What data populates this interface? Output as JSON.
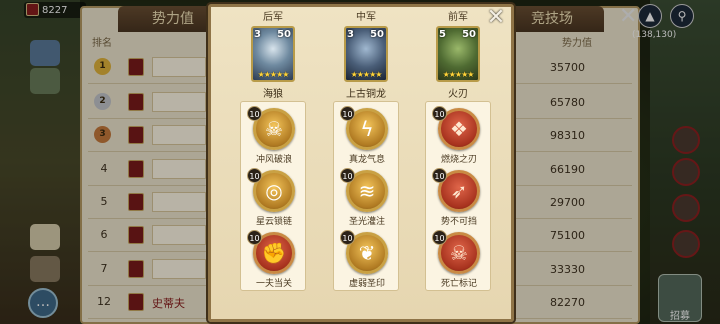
{
  "hud": {
    "resource_value": "8227",
    "coord": "(138,130)"
  },
  "ranking": {
    "tab_power": "势力值",
    "tab_arena": "竞技场",
    "col_rank": "排名",
    "col_power": "势力值",
    "rows": [
      {
        "rank": "1",
        "power": "35700",
        "medal": "gold"
      },
      {
        "rank": "2",
        "power": "65780",
        "medal": "silver"
      },
      {
        "rank": "3",
        "power": "98310",
        "medal": "bronze"
      },
      {
        "rank": "4",
        "power": "66190"
      },
      {
        "rank": "5",
        "power": "29700"
      },
      {
        "rank": "6",
        "power": "75100"
      },
      {
        "rank": "7",
        "power": "33330"
      },
      {
        "rank": "12",
        "power": "82270",
        "name": "史蒂夫"
      }
    ]
  },
  "recruit_label": "招募",
  "formation": {
    "columns": [
      {
        "position": "后军",
        "hero": {
          "name": "海狼",
          "tier": "3",
          "level": "50",
          "stars": "★★★★★"
        },
        "skills": [
          {
            "level": "10",
            "name": "冲风破浪",
            "icon": "skull-crossbones-icon",
            "glyph": "☠",
            "style": "gold"
          },
          {
            "level": "10",
            "name": "星云锁链",
            "icon": "spiral-chain-icon",
            "glyph": "◎",
            "style": "gold"
          },
          {
            "level": "10",
            "name": "一夫当关",
            "icon": "fist-icon",
            "glyph": "✊",
            "style": "red"
          }
        ]
      },
      {
        "position": "中军",
        "hero": {
          "name": "上古铜龙",
          "tier": "3",
          "level": "50",
          "stars": "★★★★★"
        },
        "skills": [
          {
            "level": "10",
            "name": "真龙气息",
            "icon": "lightning-icon",
            "glyph": "ϟ",
            "style": "gold"
          },
          {
            "level": "10",
            "name": "圣光灌注",
            "icon": "whirlwind-icon",
            "glyph": "≋",
            "style": "gold"
          },
          {
            "level": "10",
            "name": "虚弱圣印",
            "icon": "paw-seal-icon",
            "glyph": "❦",
            "style": "gold"
          }
        ]
      },
      {
        "position": "前军",
        "hero": {
          "name": "火刃",
          "tier": "5",
          "level": "50",
          "stars": "★★★★★"
        },
        "skills": [
          {
            "level": "10",
            "name": "燃烧之刃",
            "icon": "claw-paw-icon",
            "glyph": "❖",
            "style": "red"
          },
          {
            "level": "10",
            "name": "势不可挡",
            "icon": "dash-arrow-icon",
            "glyph": "➶",
            "style": "red"
          },
          {
            "level": "10",
            "name": "死亡标记",
            "icon": "skull-mark-icon",
            "glyph": "☠",
            "style": "red"
          }
        ]
      }
    ]
  },
  "colors": {
    "frame": "#8f7447",
    "panel": "#efe3c3",
    "gold": "#c9a144"
  }
}
